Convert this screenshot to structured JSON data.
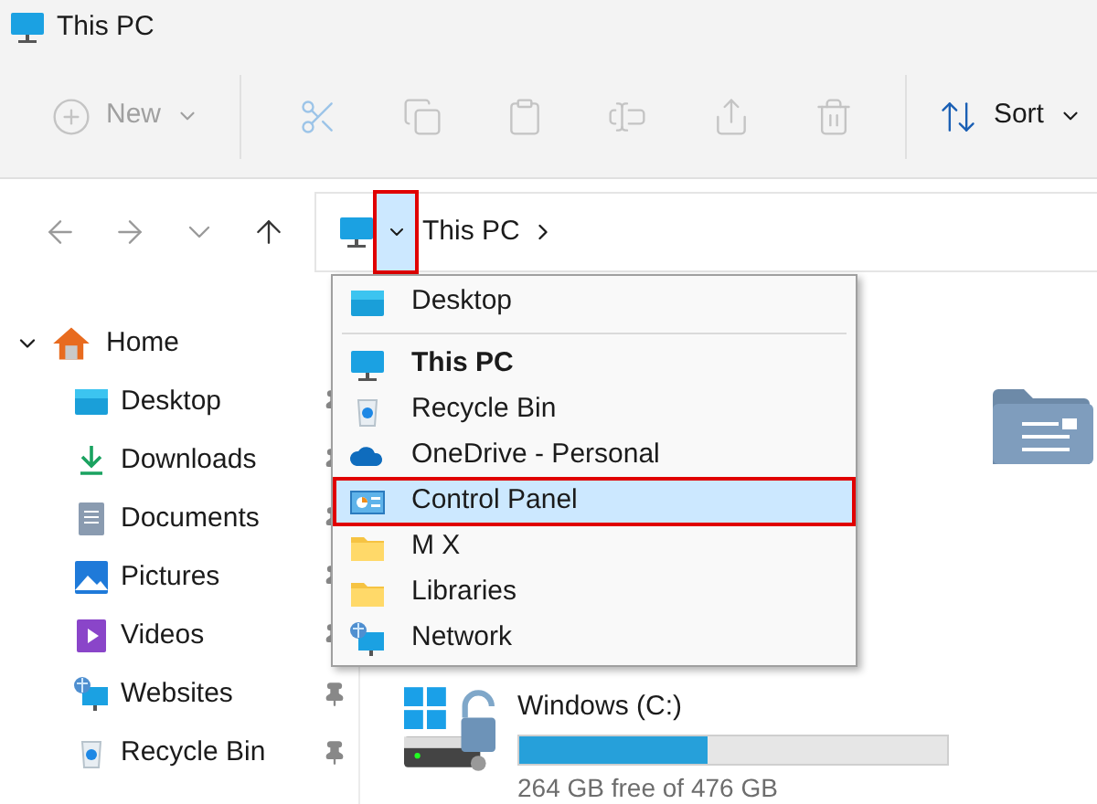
{
  "window": {
    "title": "This PC"
  },
  "toolbar": {
    "items": [
      {
        "kind": "new",
        "label": "New",
        "disabled": true
      },
      {
        "kind": "cut",
        "disabled": true
      },
      {
        "kind": "copy",
        "disabled": true
      },
      {
        "kind": "paste",
        "disabled": true
      },
      {
        "kind": "rename",
        "disabled": true
      },
      {
        "kind": "share",
        "disabled": true
      },
      {
        "kind": "delete",
        "disabled": true
      },
      {
        "kind": "sort",
        "label": "Sort",
        "disabled": false
      }
    ]
  },
  "nav": {
    "buttons": [
      {
        "kind": "back",
        "disabled": true
      },
      {
        "kind": "forward",
        "disabled": true
      },
      {
        "kind": "recent",
        "disabled": true
      },
      {
        "kind": "up",
        "disabled": false
      }
    ]
  },
  "address_bar": {
    "dropdown_open": true,
    "highlighted": true,
    "crumbs": [
      "This PC"
    ]
  },
  "location_menu": {
    "items": [
      {
        "kind": "desktop",
        "label": "Desktop",
        "bold": false,
        "selected": false,
        "highlighted": false
      },
      {
        "kind": "separator"
      },
      {
        "kind": "pc",
        "label": "This PC",
        "bold": true,
        "selected": false,
        "highlighted": false
      },
      {
        "kind": "recycle",
        "label": "Recycle Bin",
        "bold": false,
        "selected": false,
        "highlighted": false
      },
      {
        "kind": "cloud",
        "label": "OneDrive - Personal",
        "bold": false,
        "selected": false,
        "highlighted": false
      },
      {
        "kind": "control",
        "label": "Control Panel",
        "bold": false,
        "selected": true,
        "highlighted": true
      },
      {
        "kind": "folder",
        "label": "M X",
        "bold": false,
        "selected": false,
        "highlighted": false
      },
      {
        "kind": "folder",
        "label": "Libraries",
        "bold": false,
        "selected": false,
        "highlighted": false
      },
      {
        "kind": "network",
        "label": "Network",
        "bold": false,
        "selected": false,
        "highlighted": false
      }
    ]
  },
  "sidebar": {
    "items": [
      {
        "kind": "home",
        "label": "Home",
        "expanded": true,
        "children": [
          {
            "kind": "desktop",
            "label": "Desktop",
            "pinned": true
          },
          {
            "kind": "download",
            "label": "Downloads",
            "pinned": true
          },
          {
            "kind": "documents",
            "label": "Documents",
            "pinned": true
          },
          {
            "kind": "pictures",
            "label": "Pictures",
            "pinned": true
          },
          {
            "kind": "videos",
            "label": "Videos",
            "pinned": true
          },
          {
            "kind": "network",
            "label": "Websites",
            "pinned": true
          },
          {
            "kind": "recycle",
            "label": "Recycle Bin",
            "pinned": true
          }
        ]
      }
    ]
  },
  "drives": [
    {
      "label": "Windows (C:)",
      "level": 0.44,
      "space": "264 GB free of 476 GB"
    }
  ]
}
